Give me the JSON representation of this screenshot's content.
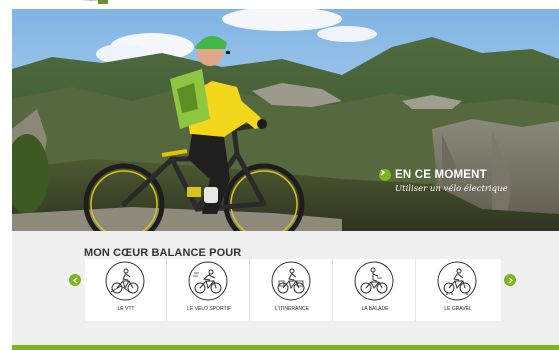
{
  "header": {
    "logo_fragment": "rhapsody"
  },
  "hero": {
    "badge_title": "EN CE MOMENT",
    "badge_subtitle": "Utiliser un vélo électrique"
  },
  "section": {
    "title": "MON CŒUR BALANCE POUR",
    "items": [
      {
        "label": "LE VTT",
        "icon": "mountain-bike-icon"
      },
      {
        "label": "LE VELO SPORTIF",
        "icon": "road-bike-icon"
      },
      {
        "label": "L'ITINERANCE",
        "icon": "touring-bike-icon"
      },
      {
        "label": "LA BALADE",
        "icon": "leisure-bike-icon"
      },
      {
        "label": "LE GRAVEL",
        "icon": "gravel-bike-icon"
      }
    ]
  },
  "colors": {
    "accent": "#7ab51d",
    "accent_dark": "#6b8f2a"
  }
}
